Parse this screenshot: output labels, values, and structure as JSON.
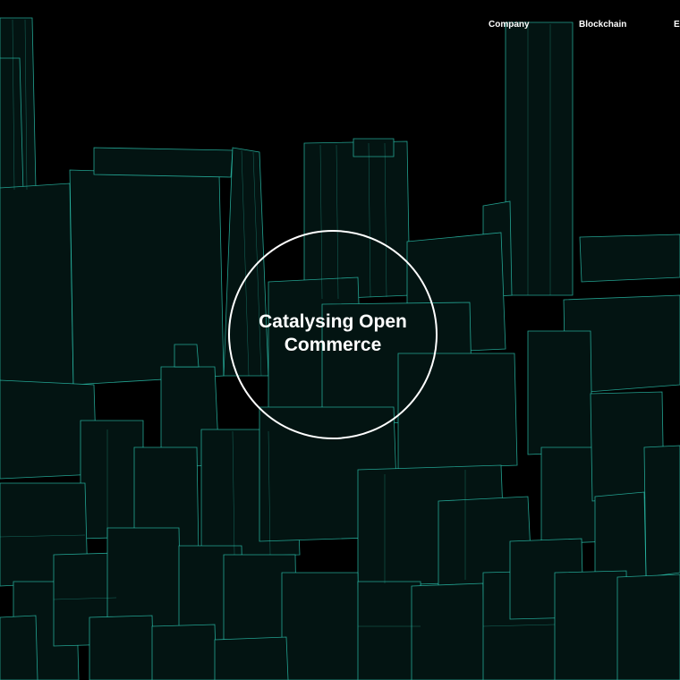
{
  "nav": {
    "items": [
      {
        "label": "Company"
      },
      {
        "label": "Blockchain"
      },
      {
        "label": "E"
      }
    ]
  },
  "hero": {
    "title": "Catalysing Open Commerce"
  },
  "colors": {
    "background": "#000000",
    "wireframe": "#2fd4bd",
    "text": "#ffffff"
  }
}
